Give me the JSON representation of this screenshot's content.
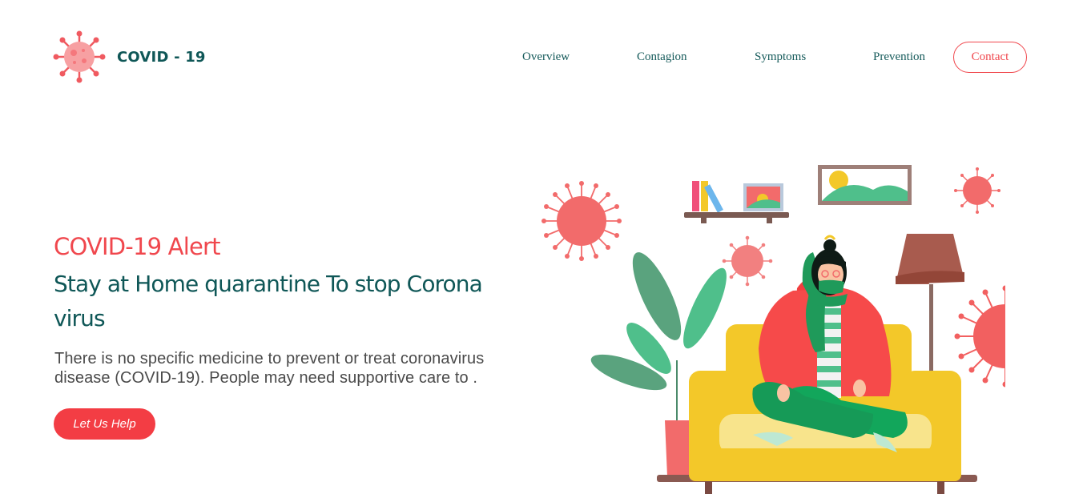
{
  "header": {
    "logo_icon": "virus-icon",
    "brand": "COVID - 19",
    "nav": [
      "Overview",
      "Contagion",
      "Symptoms",
      "Prevention"
    ],
    "contact_label": "Contact"
  },
  "hero": {
    "alert": "COVID-19 Alert",
    "headline": "Stay at Home quarantine To stop Corona virus",
    "description": "There is no specific medicine to prevent or treat coronavirus disease (COVID-19). People may need supportive care to .",
    "cta_label": "Let Us Help"
  },
  "colors": {
    "primary_red": "#f0474d",
    "heading_teal": "#0f5757",
    "text_gray": "#4a4a4a",
    "sofa_yellow": "#f3c829",
    "plant_green": "#4fbf8b",
    "pants_green": "#12a65b"
  }
}
